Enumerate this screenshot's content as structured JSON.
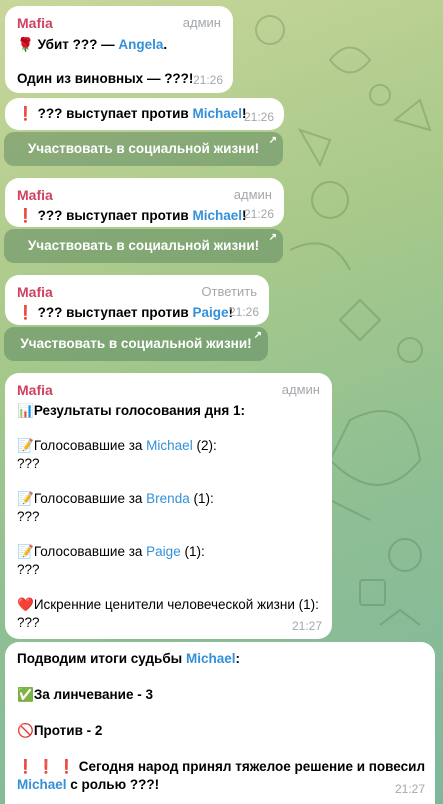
{
  "colors": {
    "sender": "#cf4160",
    "mention": "#3390d9",
    "meta": "#a3a8ad",
    "button_bg": "rgba(64,110,80,0.38)"
  },
  "msg1": {
    "sender": "Mafia",
    "role": "админ",
    "line1_prefix": "Убит ??? — ",
    "line1_name": "Angela",
    "line1_suffix": ".",
    "line2": "Один из виновных — ???!",
    "time": "21:26"
  },
  "msg2": {
    "prefix": "??? выступает против ",
    "name": "Michael",
    "suffix": "!",
    "time": "21:26"
  },
  "btn1": {
    "label": "Участвовать в социальной жизни!"
  },
  "msg3": {
    "sender": "Mafia",
    "role": "админ",
    "prefix": "??? выступает против ",
    "name": "Michael",
    "suffix": "!",
    "time": "21:26"
  },
  "btn2": {
    "label": "Участвовать в социальной жизни!"
  },
  "msg4": {
    "sender": "Mafia",
    "role": "Ответить",
    "prefix": "??? выступает против ",
    "name": "Paige",
    "suffix": "!",
    "time": "21:26"
  },
  "btn3": {
    "label": "Участвовать в социальной жизни!"
  },
  "msg5": {
    "sender": "Mafia",
    "role": "админ",
    "title": "Результаты голосования дня 1:",
    "groups": [
      {
        "prefix": "Голосовавшие за ",
        "name": "Michael",
        "count": " (2):",
        "voters": "???"
      },
      {
        "prefix": "Голосовавшие за ",
        "name": "Brenda",
        "count": " (1):",
        "voters": "???"
      },
      {
        "prefix": "Голосовавшие за ",
        "name": "Paige",
        "count": " (1):",
        "voters": "???"
      }
    ],
    "hearts_label": "Искренние ценители человеческой жизни (1):",
    "hearts_voters": "???",
    "time": "21:27"
  },
  "msg6": {
    "title_prefix": "Подводим итоги судьбы ",
    "title_name": "Michael",
    "title_suffix": ":",
    "for_label": "За линчевание - 3",
    "against_label": "Против - 2",
    "verdict_line1": "Сегодня народ принял тяжелое решение и повесил",
    "verdict_name": "Michael",
    "verdict_line2_suffix": " с ролью ???!",
    "time": "21:27"
  }
}
